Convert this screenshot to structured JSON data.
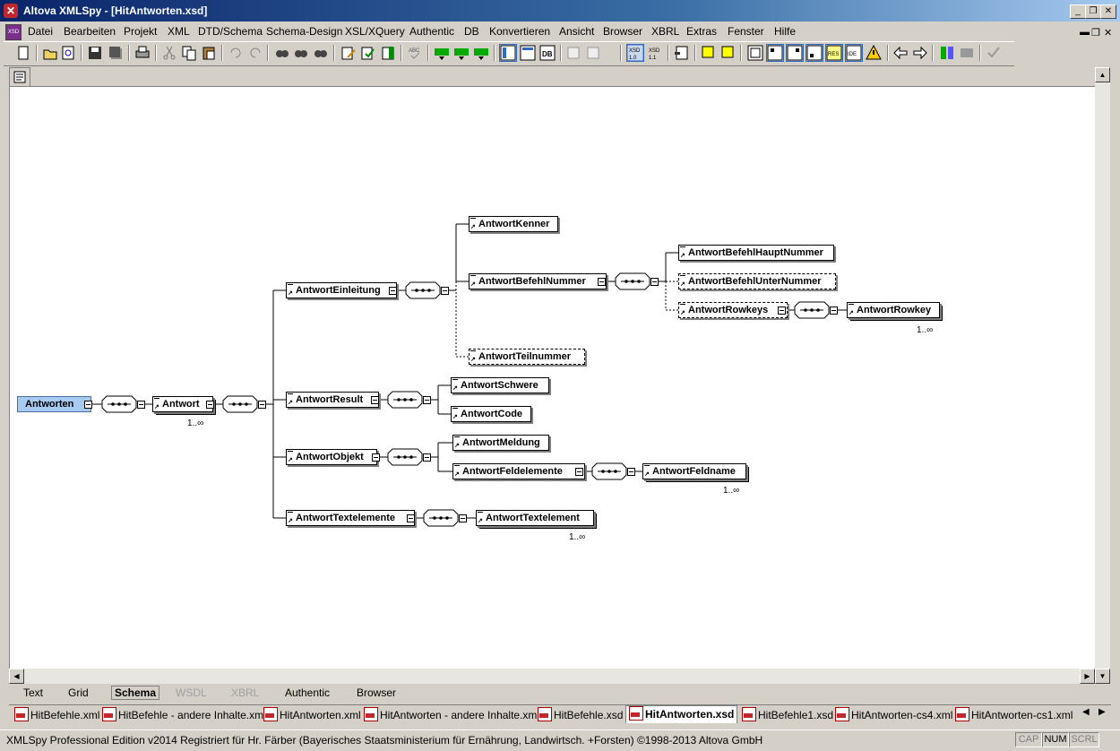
{
  "window": {
    "title": "Altova XMLSpy - [HitAntworten.xsd]",
    "controls": [
      "minimize",
      "restore",
      "close"
    ]
  },
  "menu": [
    "Datei",
    "Bearbeiten",
    "Projekt",
    "XML",
    "DTD/Schema",
    "Schema-Design",
    "XSL/XQuery",
    "Authentic",
    "DB",
    "Konvertieren",
    "Ansicht",
    "Browser",
    "XBRL",
    "Extras",
    "Fenster",
    "Hilfe"
  ],
  "view_tabs": [
    {
      "label": "Text",
      "enabled": true
    },
    {
      "label": "Grid",
      "enabled": true
    },
    {
      "label": "Schema",
      "enabled": true,
      "active": true
    },
    {
      "label": "WSDL",
      "enabled": false
    },
    {
      "label": "XBRL",
      "enabled": false
    },
    {
      "label": "Authentic",
      "enabled": true
    },
    {
      "label": "Browser",
      "enabled": true
    }
  ],
  "doc_tabs": [
    "HitBefehle.xml",
    "HitBefehle - andere Inhalte.xml",
    "HitAntworten.xml",
    "HitAntworten - andere Inhalte.xml",
    "HitBefehle.xsd",
    "HitAntworten.xsd",
    "HitBefehle1.xsd",
    "HitAntworten-cs4.xml",
    "HitAntworten-cs1.xml"
  ],
  "active_doc_tab": "HitAntworten.xsd",
  "status": {
    "text": "XMLSpy Professional Edition v2014   Registriert für Hr. Färber (Bayerisches Staatsministerium für Ernährung, Landwirtsch. +Forsten)   ©1998-2013 Altova GmbH",
    "indicators": [
      "CAP",
      "NUM",
      "SCRL"
    ]
  },
  "toolbar": {
    "xsd10": "XSD 1.0",
    "xsd11": "XSD 1.1"
  },
  "schema": {
    "root": "Antworten",
    "antwort": "Antwort",
    "antwort_occ": "1..∞",
    "children": {
      "einleitung": "AntwortEinleitung",
      "kenner": "AntwortKenner",
      "befehlnummer": "AntwortBefehlNummer",
      "hauptnummer": "AntwortBefehlHauptNummer",
      "unternummer": "AntwortBefehlUnterNummer",
      "rowkeys": "AntwortRowkeys",
      "rowkey": "AntwortRowkey",
      "rowkey_occ": "1..∞",
      "teilnummer": "AntwortTeilnummer",
      "result": "AntwortResult",
      "schwere": "AntwortSchwere",
      "code": "AntwortCode",
      "objekt": "AntwortObjekt",
      "meldung": "AntwortMeldung",
      "feldelemente": "AntwortFeldelemente",
      "feldname": "AntwortFeldname",
      "feldname_occ": "1..∞",
      "textelemente": "AntwortTextelemente",
      "textelement": "AntwortTextelement",
      "textelement_occ": "1..∞"
    }
  }
}
